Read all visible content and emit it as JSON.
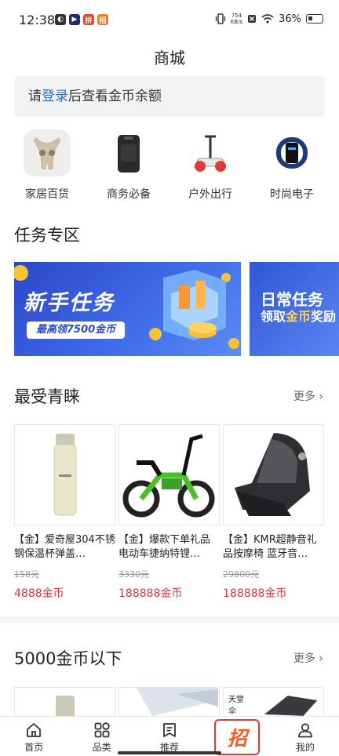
{
  "status": {
    "time": "12:38",
    "speed_value": "754",
    "speed_unit": "KB/s",
    "battery": "36%"
  },
  "page_title": "商城",
  "login_bar": {
    "prefix": "请",
    "link": "登录",
    "suffix": "后查看金币余额"
  },
  "categories": [
    {
      "label": "家居百货",
      "icon": "massager-icon"
    },
    {
      "label": "商务必备",
      "icon": "backpack-icon"
    },
    {
      "label": "户外出行",
      "icon": "scooter-icon"
    },
    {
      "label": "时尚电子",
      "icon": "smart-band-icon"
    }
  ],
  "tasks": {
    "title": "任务专区",
    "banner1_title": "新手任务",
    "banner1_sub": "最高领7500金币",
    "banner2_title": "日常任务",
    "banner2_sub_pre": "领取",
    "banner2_sub_gold": "金币",
    "banner2_sub_post": "奖励"
  },
  "favorites": {
    "title": "最受青睐",
    "more": "更多",
    "products": [
      {
        "name": "【金】爱奇屋304不锈钢保温杯弹盖…",
        "old_price": "158元",
        "price": "4888金币",
        "image": "thermos-icon"
      },
      {
        "name": "【金】爆款下单礼品电动车捷纳特锂…",
        "old_price": "3330元",
        "price": "188888金币",
        "image": "ebike-icon"
      },
      {
        "name": "【金】KMR超静音礼品按摩椅 蓝牙音…",
        "old_price": "29800元",
        "price": "188888金币",
        "image": "massage-chair-icon"
      }
    ]
  },
  "under5000": {
    "title": "5000金币以下",
    "more": "更多",
    "brand_text": "天堂伞"
  },
  "bottom_nav": [
    {
      "label": "首页",
      "icon": "home-icon"
    },
    {
      "label": "品类",
      "icon": "category-icon"
    },
    {
      "label": "推荐",
      "icon": "recommend-icon"
    },
    {
      "label": "招",
      "icon": "zhao-icon"
    },
    {
      "label": "我的",
      "icon": "profile-icon"
    }
  ],
  "colors": {
    "accent_link": "#2a6ecf",
    "price_red": "#e0333a",
    "banner_blue": "#3f6ae8",
    "highlight_red": "#e53935"
  }
}
